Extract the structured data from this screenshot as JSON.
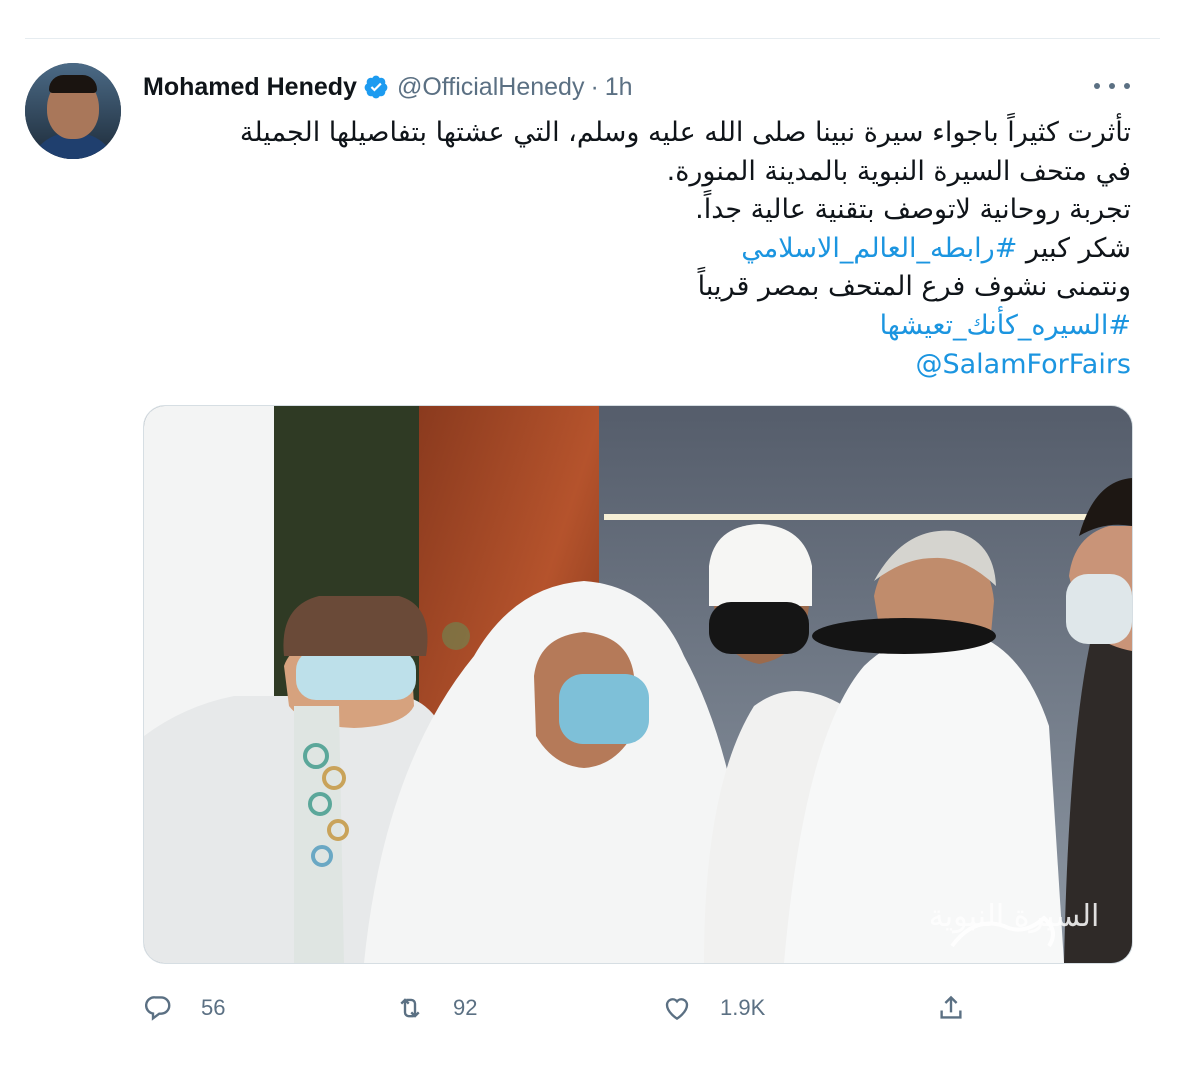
{
  "tweet": {
    "author": {
      "display_name": "Mohamed Henedy",
      "handle": "@OfficialHenedy",
      "separator": "·",
      "time": "1h",
      "verified": true
    },
    "text_lines": [
      "تأثرت كثيراً باجواء سيرة نبينا صلى الله عليه وسلم، التي عشتها بتفاصيلها الجميلة",
      "في متحف السيرة النبوية بالمدينة المنورة.",
      "تجربة روحانية لاتوصف بتقنية عالية جداً.",
      "ونتمنى نشوف فرع المتحف بمصر قريباً"
    ],
    "thanks_prefix": "شكر كبير ",
    "hashtag_1": "#رابطه_العالم_الاسلامي",
    "hashtag_2": "#السيره_كأنك_تعيشها",
    "mention": "@SalamForFairs",
    "photo_signature": "السيرة النبوية",
    "stats": {
      "replies": "56",
      "retweets": "92",
      "likes": "1.9K"
    }
  },
  "colors": {
    "link": "#1b95e0",
    "verified": "#1d9bf0",
    "secondary_text": "#5b7083"
  },
  "icons": [
    "verified-badge-icon",
    "more-icon",
    "reply-icon",
    "retweet-icon",
    "like-icon",
    "share-icon"
  ]
}
